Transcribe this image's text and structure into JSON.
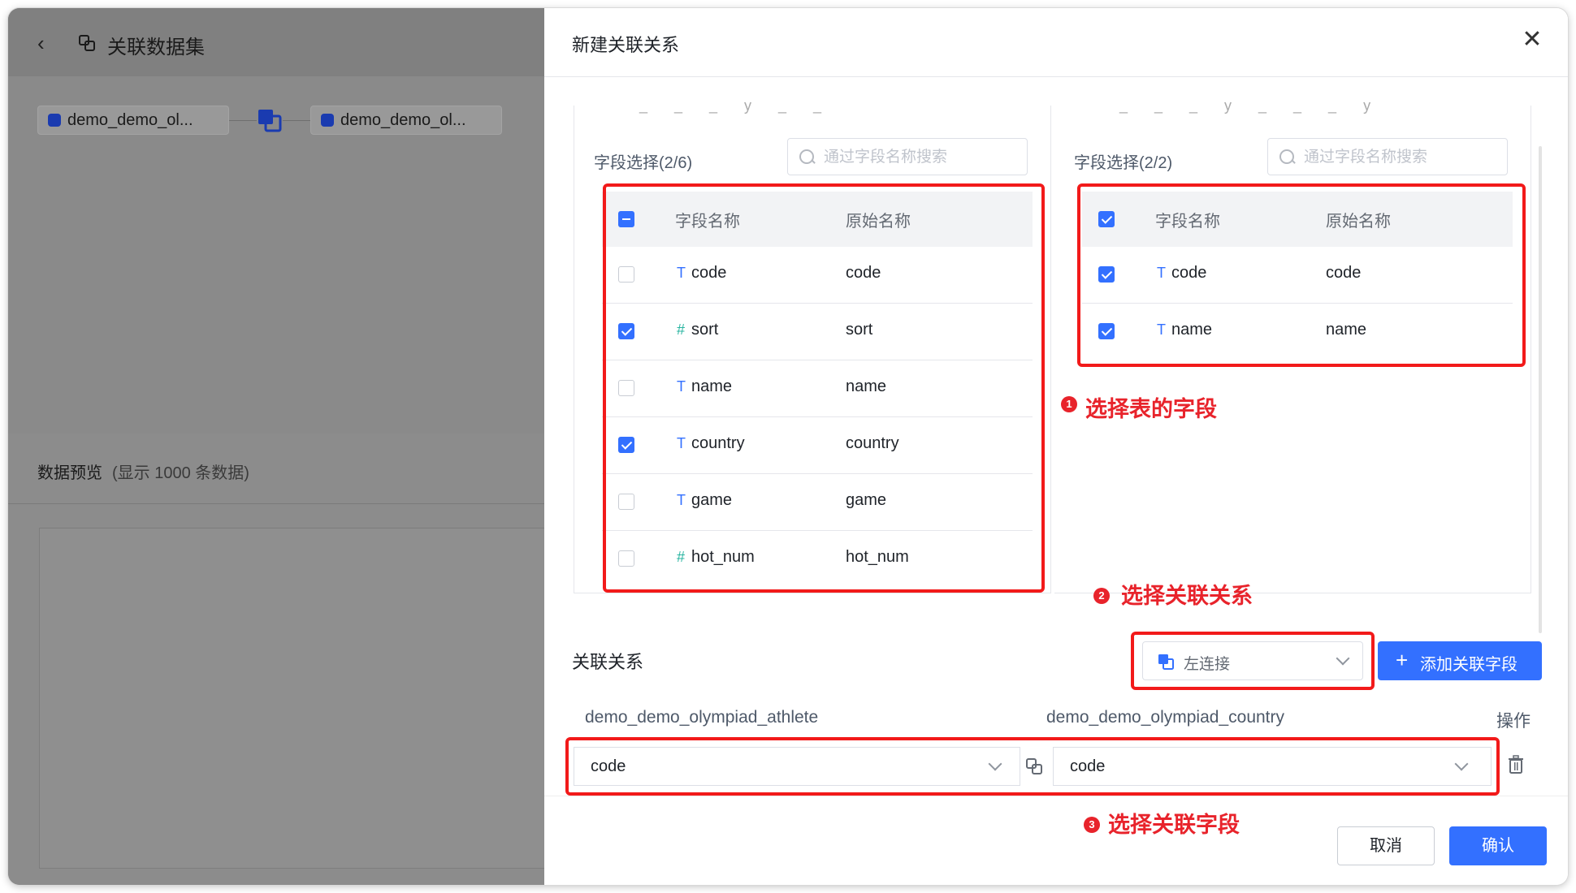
{
  "background": {
    "back_glyph": "‹",
    "title": "关联数据集",
    "nodes": [
      "demo_demo_ol...",
      "demo_demo_ol..."
    ],
    "preview_title": "数据预览",
    "preview_sub": "(显示 1000 条数据)"
  },
  "drawer": {
    "title": "新建关联关系",
    "close_glyph": "✕"
  },
  "left_panel": {
    "cut_text": "_ _ _ y _ _",
    "field_label": "字段选择(2/6)",
    "search_placeholder": "通过字段名称搜索",
    "header_name": "字段名称",
    "header_orig": "原始名称",
    "header_check": "indeterminate",
    "rows": [
      {
        "type": "T",
        "name": "code",
        "orig": "code",
        "checked": false
      },
      {
        "type": "#",
        "name": "sort",
        "orig": "sort",
        "checked": true
      },
      {
        "type": "T",
        "name": "name",
        "orig": "name",
        "checked": false
      },
      {
        "type": "T",
        "name": "country",
        "orig": "country",
        "checked": true
      },
      {
        "type": "T",
        "name": "game",
        "orig": "game",
        "checked": false
      },
      {
        "type": "#",
        "name": "hot_num",
        "orig": "hot_num",
        "checked": false
      }
    ]
  },
  "right_panel": {
    "cut_text": "_ _ _ y _ _ _ y",
    "field_label": "字段选择(2/2)",
    "search_placeholder": "通过字段名称搜索",
    "header_name": "字段名称",
    "header_orig": "原始名称",
    "header_check": "checked",
    "rows": [
      {
        "type": "T",
        "name": "code",
        "orig": "code",
        "checked": true
      },
      {
        "type": "T",
        "name": "name",
        "orig": "name",
        "checked": true
      }
    ]
  },
  "annotations": {
    "a1_num": "1",
    "a1_text": "选择表的字段",
    "a2_num": "2",
    "a2_text": "选择关联关系",
    "a3_num": "3",
    "a3_text": "选择关联字段",
    "color": "#e8232b"
  },
  "relation": {
    "title": "关联关系",
    "join_type": "左连接",
    "add_button": "添加关联字段",
    "add_plus": "+",
    "left_table": "demo_demo_olympiad_athlete",
    "right_table": "demo_demo_olympiad_country",
    "op_header": "操作",
    "left_field": "code",
    "right_field": "code"
  },
  "footer": {
    "cancel": "取消",
    "confirm": "确认"
  },
  "colors": {
    "primary": "#3370ff",
    "annotation_red": "#f21a1a"
  }
}
